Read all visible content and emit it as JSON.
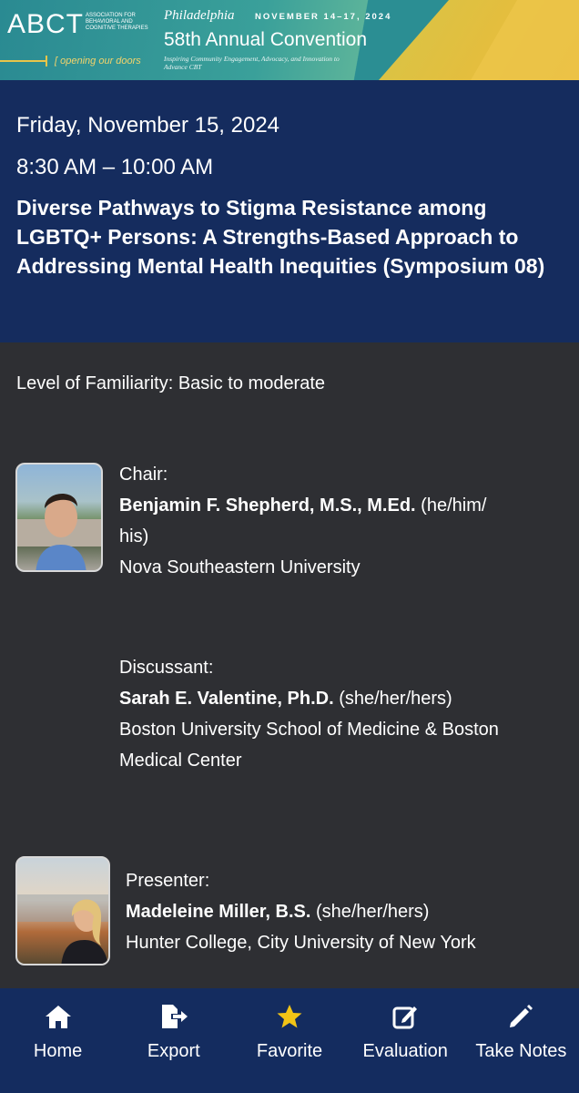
{
  "banner": {
    "logo": "ABCT",
    "logo_sub": "Association for Behavioral and Cognitive Therapies",
    "tagline": "opening our doors",
    "city": "Philadelphia",
    "dates": "NOVEMBER 14–17, 2024",
    "title": "58th Annual Convention",
    "description": "Inspiring Community Engagement, Advocacy, and Innovation to Advance CBT"
  },
  "session": {
    "date": "Friday, November 15, 2024",
    "time": "8:30 AM – 10:00 AM",
    "title": "Diverse Pathways to Stigma Resistance among LGBTQ+ Persons: A Strengths-Based Approach to Addressing Mental Health Inequities (Symposium 08)",
    "familiarity": "Level of Familiarity: Basic to moderate"
  },
  "people": [
    {
      "role": "Chair:",
      "name": "Benjamin F. Shepherd, M.S., M.Ed.",
      "pronouns": "(he/him/his)",
      "affiliation": "Nova Southeastern University"
    },
    {
      "role": "Discussant:",
      "name": "Sarah E. Valentine, Ph.D.",
      "pronouns": "(she/her/hers)",
      "affiliation": "Boston University School of Medicine & Boston Medical Center"
    },
    {
      "role": "Presenter:",
      "name": "Madeleine Miller, B.S.",
      "pronouns": "(she/her/hers)",
      "affiliation": "Hunter College, City University of New York"
    }
  ],
  "nav": [
    {
      "label": "Home",
      "icon": "home-icon"
    },
    {
      "label": "Export",
      "icon": "export-icon"
    },
    {
      "label": "Favorite",
      "icon": "star-icon"
    },
    {
      "label": "Evaluation",
      "icon": "edit-icon"
    },
    {
      "label": "Take Notes",
      "icon": "pencil-icon"
    }
  ],
  "colors": {
    "header_bg": "#152c5e",
    "body_bg": "#2e2f33",
    "nav_bg": "#142c5f",
    "star": "#f2c416"
  }
}
